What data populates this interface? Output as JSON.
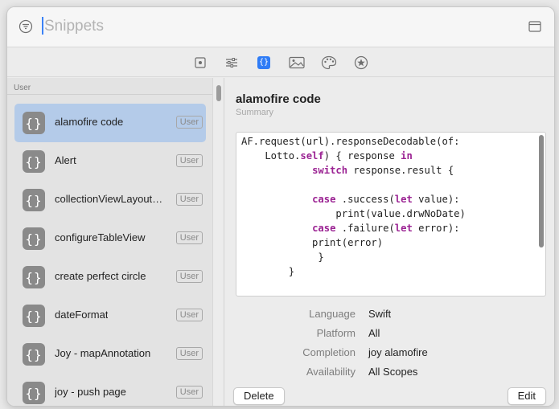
{
  "search": {
    "placeholder": "Snippets"
  },
  "toolbar": {
    "tools": [
      {
        "icon": "general-icon"
      },
      {
        "icon": "sliders-icon"
      },
      {
        "icon": "code-snippets-icon",
        "active": true
      },
      {
        "icon": "image-icon"
      },
      {
        "icon": "palette-icon"
      },
      {
        "icon": "star-icon"
      }
    ]
  },
  "sidebar": {
    "section_header": "User",
    "items": [
      {
        "name": "alamofire code",
        "tag": "User",
        "selected": true
      },
      {
        "name": "Alert",
        "tag": "User"
      },
      {
        "name": "collectionViewLayout…",
        "tag": "User"
      },
      {
        "name": "configureTableView",
        "tag": "User"
      },
      {
        "name": "create perfect circle",
        "tag": "User"
      },
      {
        "name": "dateFormat",
        "tag": "User"
      },
      {
        "name": "Joy - mapAnnotation",
        "tag": "User"
      },
      {
        "name": "joy - push page",
        "tag": "User"
      }
    ],
    "item_icon_glyph": "{}"
  },
  "detail": {
    "title": "alamofire code",
    "summary": "Summary",
    "code_lines": [
      "AF.request(url).responseDecodable(of:",
      "    Lotto.self) { response in",
      "            switch response.result {",
      "",
      "            case .success(let value):",
      "                print(value.drwNoDate)",
      "            case .failure(let error):",
      "            print(error)",
      "             }",
      "        }"
    ],
    "properties": [
      {
        "label": "Language",
        "value": "Swift"
      },
      {
        "label": "Platform",
        "value": "All"
      },
      {
        "label": "Completion",
        "value": "joy alamofire"
      },
      {
        "label": "Availability",
        "value": "All Scopes"
      }
    ],
    "delete_label": "Delete",
    "edit_label": "Edit"
  },
  "colors": {
    "accent": "#2f7cf6",
    "selection": "#b4cbe9",
    "keyword": "#9b2393"
  }
}
